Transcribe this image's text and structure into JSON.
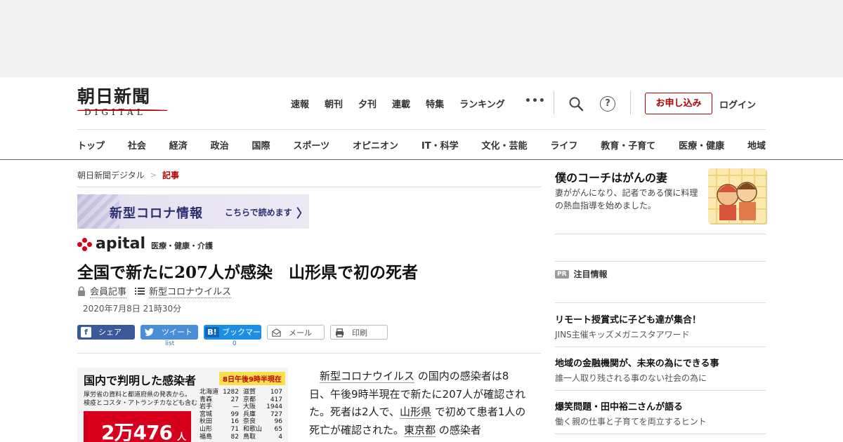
{
  "header": {
    "logo_jp": "朝日新聞",
    "logo_en": "DIGITAL",
    "top_nav": [
      "速報",
      "朝刊",
      "夕刊",
      "連載",
      "特集",
      "ランキング"
    ],
    "more": "•••",
    "help": "?",
    "apply_button": "お申し込み",
    "login": "ログイン",
    "categories": [
      "トップ",
      "社会",
      "経済",
      "政治",
      "国際",
      "スポーツ",
      "オピニオン",
      "IT・科学",
      "文化・芸能",
      "ライフ",
      "教育・子育て",
      "医療・健康",
      "地域"
    ]
  },
  "breadcrumb": {
    "home": "朝日新聞デジタル",
    "sep": ">",
    "current": "記事"
  },
  "banner": {
    "title": "新型コロナ情報",
    "link": "こちらで読めます",
    "arrow": "〉"
  },
  "apital": {
    "word": "apital",
    "sub": "医療・健康・介護"
  },
  "article": {
    "headline": "全国で新たに207人が感染　山形県で初の死者",
    "member": "会員記事",
    "topic": "新型コロナウイルス",
    "date": "2020年7月8日 21時30分",
    "body": {
      "indent": "　",
      "p1_link1": "新型コロナウイルス",
      "p1_a": " の国内の感染者は8日、午後9時半現在で新たに207人が確認された。死者は2人で、",
      "p1_link2": "山形県",
      "p1_b": " で初めて患者1人の死亡が確認された。",
      "p1_link3": "東京都",
      "p1_c": " の感染者"
    }
  },
  "share": {
    "facebook": "シェア",
    "twitter": "ツイート",
    "hatena": "ブックマーク",
    "hatena_icon": "B!",
    "mail": "メール",
    "print": "印刷",
    "twitter_count": "list",
    "hatena_count": "0"
  },
  "infographic": {
    "title": "国内で判明した感染者",
    "as_of": "8日午後9時半現在",
    "source_line1": "厚労省の資料と都道府県の発表から。",
    "source_line2": "検疫とコスタ・アトランチカなども含む",
    "total": "2万476",
    "unit": "人",
    "prefectures": [
      [
        [
          "北海道",
          "1282"
        ],
        [
          "滋賀",
          "107"
        ]
      ],
      [
        [
          "青森",
          "27"
        ],
        [
          "京都",
          "417"
        ]
      ],
      [
        [
          "岩手",
          "—"
        ],
        [
          "大阪",
          "1944"
        ]
      ],
      [
        [
          "宮城",
          "99"
        ],
        [
          "兵庫",
          "727"
        ]
      ],
      [
        [
          "秋田",
          "16"
        ],
        [
          "奈良",
          "96"
        ]
      ],
      [
        [
          "山形",
          "71"
        ],
        [
          "和歌山",
          "65"
        ]
      ],
      [
        [
          "福島",
          "82"
        ],
        [
          "鳥取",
          "4"
        ]
      ]
    ]
  },
  "sidebar": {
    "feature_title": "僕のコーチはがんの妻",
    "feature_desc": "妻ががんになり、記者である僕に料理の熱血指導を始めました。",
    "pr_badge": "PR",
    "pr_heading": "注目情報",
    "pr_items": [
      {
        "title": "リモート授賞式に子ども達が集合！",
        "sub": "JINS主催キッズメガニスタアワード"
      },
      {
        "title": "地域の金融機関が、未来の為にできる事",
        "sub": "誰一人取り残される事のない社会の為に"
      },
      {
        "title": "爆笑問題・田中裕二さんが語る",
        "sub": "働く親の仕事と子育てを両立するヒント"
      }
    ]
  },
  "colors": {
    "brand_red": "#b30000",
    "accent_red": "#d6001c",
    "facebook": "#3b5998",
    "twitter": "#4a8fd6",
    "hatena": "#1d8fe3"
  }
}
